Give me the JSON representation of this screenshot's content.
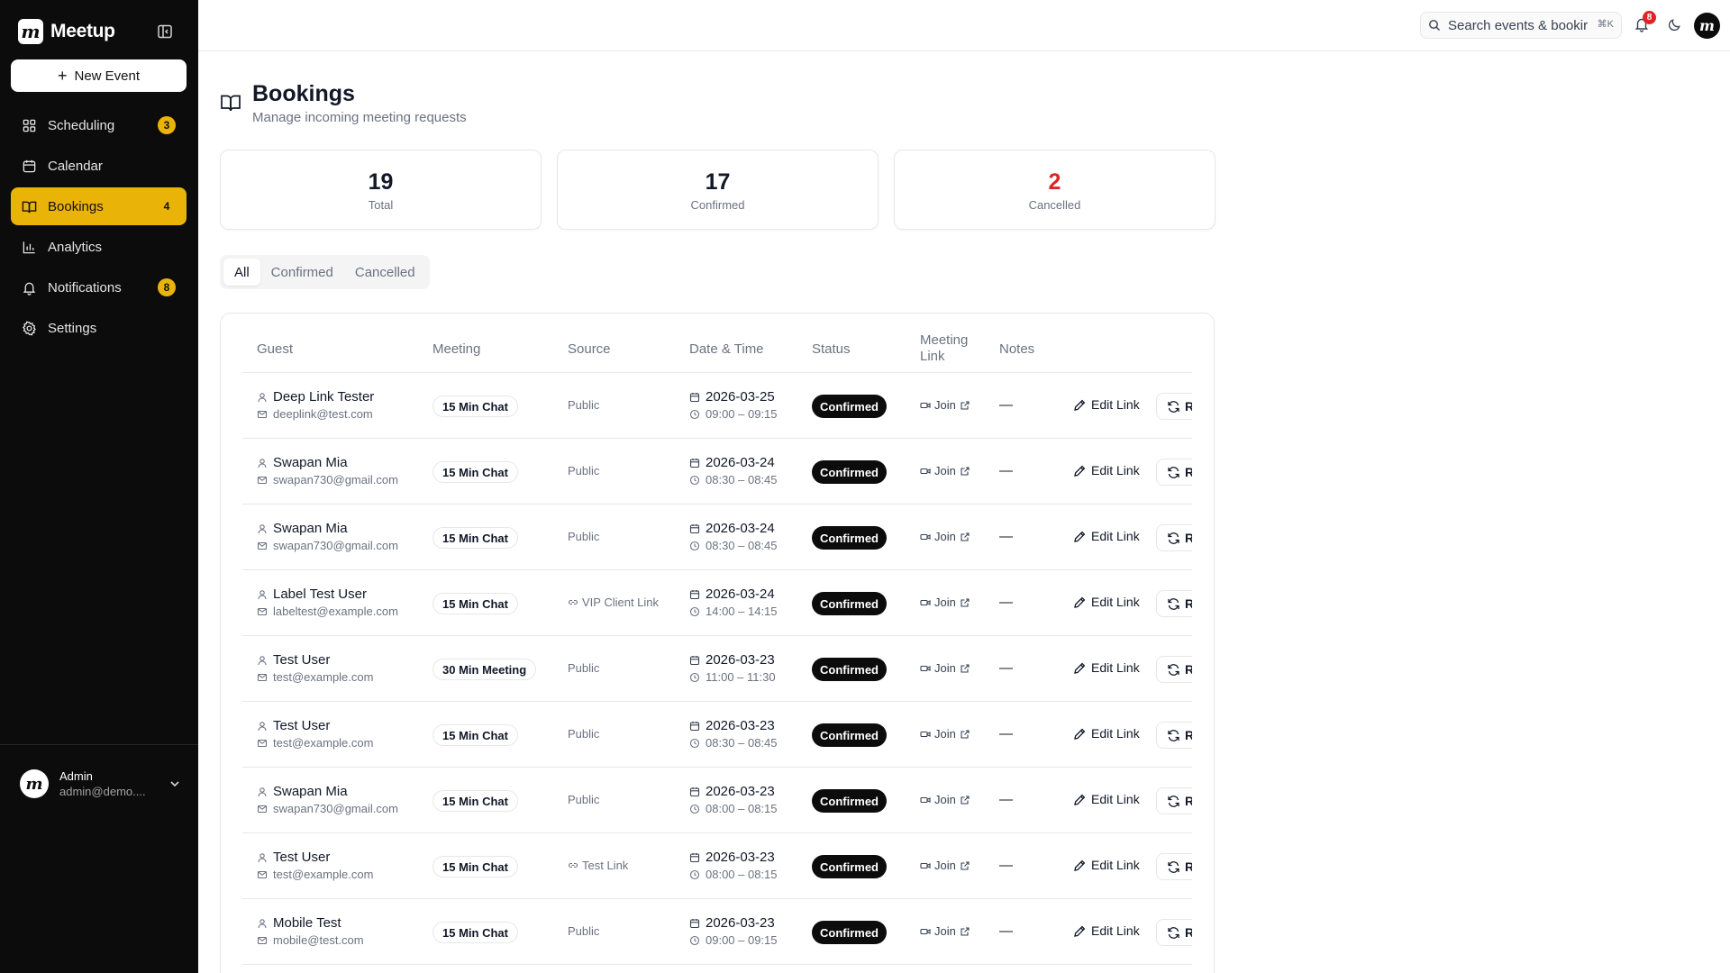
{
  "app": {
    "name": "Meetup",
    "logo_letter": "m"
  },
  "sidebar": {
    "new_event_label": "New Event",
    "items": [
      {
        "label": "Scheduling",
        "icon": "grid-icon",
        "badge": "3",
        "active": false
      },
      {
        "label": "Calendar",
        "icon": "calendar-icon",
        "badge": "",
        "active": false
      },
      {
        "label": "Bookings",
        "icon": "book-icon",
        "badge": "4",
        "active": true
      },
      {
        "label": "Analytics",
        "icon": "chart-icon",
        "badge": "",
        "active": false
      },
      {
        "label": "Notifications",
        "icon": "bell-icon",
        "badge": "8",
        "active": false
      },
      {
        "label": "Settings",
        "icon": "gear-icon",
        "badge": "",
        "active": false
      }
    ],
    "user": {
      "name": "Admin",
      "email": "admin@demo...."
    }
  },
  "topbar": {
    "search_placeholder": "Search events & bookir",
    "search_shortcut": "⌘K",
    "notification_count": "8"
  },
  "page": {
    "title": "Bookings",
    "subtitle": "Manage incoming meeting requests"
  },
  "stats": [
    {
      "value": "19",
      "label": "Total"
    },
    {
      "value": "17",
      "label": "Confirmed"
    },
    {
      "value": "2",
      "label": "Cancelled"
    }
  ],
  "tabs": [
    {
      "label": "All",
      "active": true
    },
    {
      "label": "Confirmed",
      "active": false
    },
    {
      "label": "Cancelled",
      "active": false
    }
  ],
  "table": {
    "headers": {
      "guest": "Guest",
      "meeting": "Meeting",
      "source": "Source",
      "datetime": "Date & Time",
      "status": "Status",
      "meeting_link_1": "Meeting",
      "meeting_link_2": "Link",
      "notes": "Notes"
    },
    "action_edit": "Edit Link",
    "action_resched": "R",
    "join_label": "Join",
    "rows": [
      {
        "name": "Deep Link Tester",
        "email": "deeplink@test.com",
        "meeting": "15 Min Chat",
        "source": "Public",
        "source_link": false,
        "date": "2026-03-25",
        "time": "09:00 – 09:15",
        "status": "Confirmed",
        "notes": "—"
      },
      {
        "name": "Swapan Mia",
        "email": "swapan730@gmail.com",
        "meeting": "15 Min Chat",
        "source": "Public",
        "source_link": false,
        "date": "2026-03-24",
        "time": "08:30 – 08:45",
        "status": "Confirmed",
        "notes": "—"
      },
      {
        "name": "Swapan Mia",
        "email": "swapan730@gmail.com",
        "meeting": "15 Min Chat",
        "source": "Public",
        "source_link": false,
        "date": "2026-03-24",
        "time": "08:30 – 08:45",
        "status": "Confirmed",
        "notes": "—"
      },
      {
        "name": "Label Test User",
        "email": "labeltest@example.com",
        "meeting": "15 Min Chat",
        "source": "VIP Client Link",
        "source_link": true,
        "date": "2026-03-24",
        "time": "14:00 – 14:15",
        "status": "Confirmed",
        "notes": "—"
      },
      {
        "name": "Test User",
        "email": "test@example.com",
        "meeting": "30 Min Meeting",
        "source": "Public",
        "source_link": false,
        "date": "2026-03-23",
        "time": "11:00 – 11:30",
        "status": "Confirmed",
        "notes": "—"
      },
      {
        "name": "Test User",
        "email": "test@example.com",
        "meeting": "15 Min Chat",
        "source": "Public",
        "source_link": false,
        "date": "2026-03-23",
        "time": "08:30 – 08:45",
        "status": "Confirmed",
        "notes": "—"
      },
      {
        "name": "Swapan Mia",
        "email": "swapan730@gmail.com",
        "meeting": "15 Min Chat",
        "source": "Public",
        "source_link": false,
        "date": "2026-03-23",
        "time": "08:00 – 08:15",
        "status": "Confirmed",
        "notes": "—"
      },
      {
        "name": "Test User",
        "email": "test@example.com",
        "meeting": "15 Min Chat",
        "source": "Test Link",
        "source_link": true,
        "date": "2026-03-23",
        "time": "08:00 – 08:15",
        "status": "Confirmed",
        "notes": "—"
      },
      {
        "name": "Mobile Test",
        "email": "mobile@test.com",
        "meeting": "15 Min Chat",
        "source": "Public",
        "source_link": false,
        "date": "2026-03-23",
        "time": "09:00 – 09:15",
        "status": "Confirmed",
        "notes": "—"
      }
    ]
  },
  "colors": {
    "sidebar_bg": "#0c0c0c",
    "accent": "#eab308",
    "cancelled_red": "#dc2626",
    "status_bg": "#0c0c0c"
  }
}
